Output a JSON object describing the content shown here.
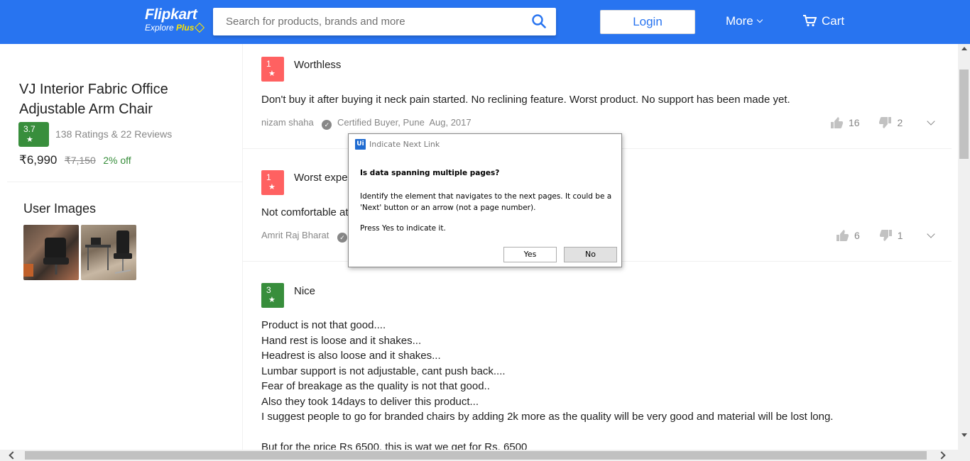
{
  "header": {
    "brand": "Flipkart",
    "tagline": "Explore",
    "tagline_plus": "Plus",
    "search_placeholder": "Search for products, brands and more",
    "login_label": "Login",
    "more_label": "More",
    "cart_label": "Cart",
    "brand_color": "#2874f0"
  },
  "product": {
    "title": "VJ Interior Fabric Office Adjustable Arm Chair",
    "rating": "3.7",
    "rating_count": "138 Ratings & 22 Reviews",
    "price": "₹6,990",
    "mrp": "₹7,150",
    "discount": "2% off",
    "user_images_title": "User Images"
  },
  "reviews": [
    {
      "rating": "1",
      "title": "Worthless",
      "text": "Don't buy it after buying it neck pain started. No reclining feature. Worst product. No support has been made yet.",
      "author": "nizam shaha",
      "certified": "Certified Buyer, Pune",
      "date": "Aug, 2017",
      "likes": "16",
      "dislikes": "2"
    },
    {
      "rating": "1",
      "title": "Worst exper",
      "text": "Not comfortable at",
      "author": "Amrit Raj Bharat",
      "likes": "6",
      "dislikes": "1"
    },
    {
      "rating": "3",
      "title": "Nice",
      "text": "Product is not that good....\nHand rest is loose and it shakes...\nHeadrest is also loose and it shakes...\nLumbar support is not adjustable, cant push back....\nFear of breakage as the quality is not that good..\nAlso they took 14days to deliver this product...\nI suggest people to go for branded chairs by adding 2k more as the quality will be very good and material will be lost long.\n\nBut for the price Rs 6500, this is wat we get for Rs. 6500"
    }
  ],
  "dialog": {
    "app_icon": "Ui",
    "title": "Indicate Next Link",
    "question": "Is data spanning multiple pages?",
    "description": "Identify the element that navigates to the next pages. It could be a 'Next' button or an arrow (not a page number).",
    "press_text": "Press Yes to indicate it.",
    "yes_label": "Yes",
    "no_label": "No"
  }
}
